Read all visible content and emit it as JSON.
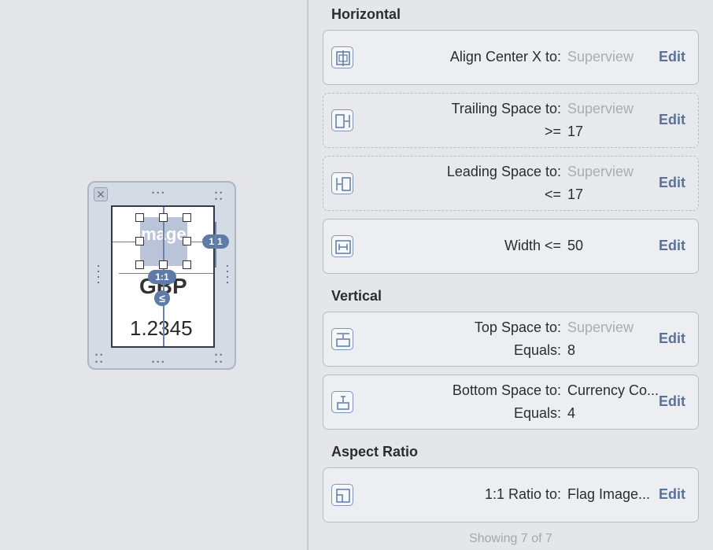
{
  "canvas": {
    "image_label": "Image",
    "code_label": "GBP",
    "rate_label": "1.2345",
    "aspect_badge_1": "1:1",
    "aspect_badge_2": "1:1",
    "lte_badge": "≤"
  },
  "sections": {
    "horizontal": "Horizontal",
    "vertical": "Vertical",
    "aspect_ratio": "Aspect Ratio"
  },
  "constraints": [
    {
      "icon": "align-center-x-icon",
      "label1": "Align Center X to:",
      "value1": "Superview",
      "value1_muted": true,
      "label2": "",
      "value2": "",
      "edit": "Edit"
    },
    {
      "icon": "trailing-space-icon",
      "label1": "Trailing Space to:",
      "value1": "Superview",
      "value1_muted": true,
      "label2": ">=",
      "value2": "17",
      "edit": "Edit"
    },
    {
      "icon": "leading-space-icon",
      "label1": "Leading Space to:",
      "value1": "Superview",
      "value1_muted": true,
      "label2": "<=",
      "value2": "17",
      "edit": "Edit"
    },
    {
      "icon": "width-icon",
      "label1": "Width <=",
      "value1": "50",
      "value1_muted": false,
      "label2": "",
      "value2": "",
      "edit": "Edit"
    },
    {
      "icon": "top-space-icon",
      "label1": "Top Space to:",
      "value1": "Superview",
      "value1_muted": true,
      "label2": "Equals:",
      "value2": "8",
      "edit": "Edit"
    },
    {
      "icon": "bottom-space-icon",
      "label1": "Bottom Space to:",
      "value1": "Currency Co...",
      "value1_muted": false,
      "label2": "Equals:",
      "value2": "4",
      "edit": "Edit"
    },
    {
      "icon": "aspect-ratio-icon",
      "label1": "1:1 Ratio to:",
      "value1": "Flag Image...",
      "value1_muted": false,
      "label2": "",
      "value2": "",
      "edit": "Edit"
    }
  ],
  "footer": "Showing 7 of 7",
  "colors": {
    "accent": "#5a7296",
    "muted_text": "#a9adb4",
    "constraint_blue": "#5d7aa8"
  }
}
